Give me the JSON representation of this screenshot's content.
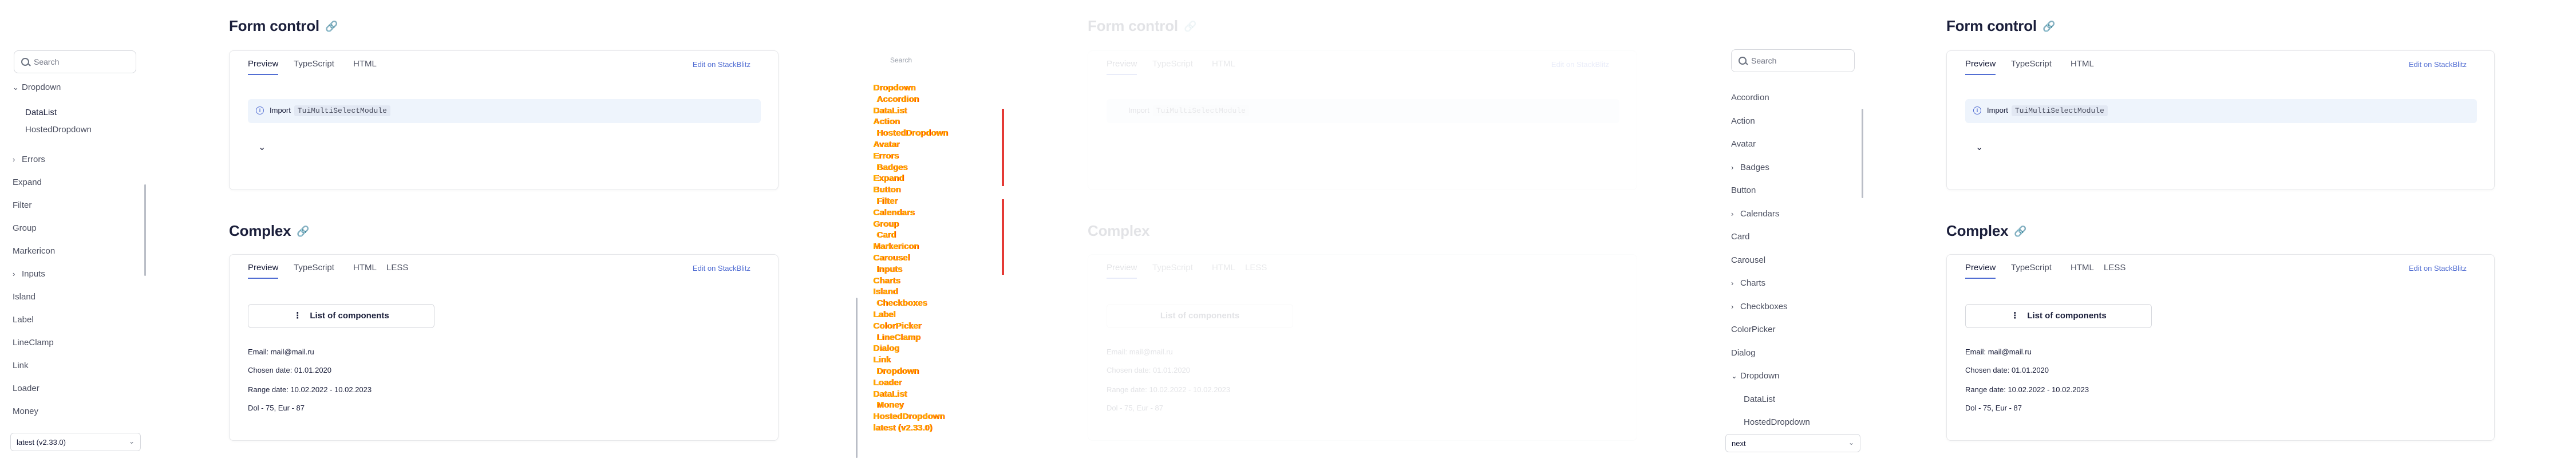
{
  "panel1": {
    "search_placeholder": "Search",
    "nav": [
      {
        "label": "Dropdown",
        "chevron": "down",
        "indent": 0,
        "active": false
      },
      {
        "label": "DataList",
        "chevron": "",
        "indent": 1,
        "active": true
      },
      {
        "label": "HostedDropdown",
        "chevron": "",
        "indent": 1,
        "active": false
      },
      {
        "label": "Errors",
        "chevron": "right",
        "indent": 0,
        "active": false
      },
      {
        "label": "Expand",
        "chevron": "",
        "indent": 0,
        "active": false
      },
      {
        "label": "Filter",
        "chevron": "",
        "indent": 0,
        "active": false
      },
      {
        "label": "Group",
        "chevron": "",
        "indent": 0,
        "active": false
      },
      {
        "label": "Markericon",
        "chevron": "",
        "indent": 0,
        "active": false
      },
      {
        "label": "Inputs",
        "chevron": "right",
        "indent": 0,
        "active": false
      },
      {
        "label": "Island",
        "chevron": "",
        "indent": 0,
        "active": false
      },
      {
        "label": "Label",
        "chevron": "",
        "indent": 0,
        "active": false
      },
      {
        "label": "LineClamp",
        "chevron": "",
        "indent": 0,
        "active": false
      },
      {
        "label": "Link",
        "chevron": "",
        "indent": 0,
        "active": false
      },
      {
        "label": "Loader",
        "chevron": "",
        "indent": 0,
        "active": false
      },
      {
        "label": "Money",
        "chevron": "",
        "indent": 0,
        "active": false
      }
    ],
    "version": "latest (v2.33.0)"
  },
  "content": {
    "section1_title": "Form control",
    "section2_title": "Complex",
    "tabs1": [
      "Preview",
      "TypeScript",
      "HTML"
    ],
    "tabs2": [
      "Preview",
      "TypeScript",
      "HTML",
      "LESS"
    ],
    "edit_label": "Edit on StackBlitz",
    "import_label": "Import",
    "module_name": "TuiMultiSelectModule",
    "list_button": "List of components",
    "email": "Email: mail@mail.ru",
    "chosen_date": "Chosen date: 01.01.2020",
    "range_date": "Range date: 10.02.2022 - 10.02.2023",
    "money": "Dol - 75, Eur - 87"
  },
  "glitch": {
    "search_placeholder": "Search",
    "lines": [
      "Dropdown",
      "Accordion",
      "DataList",
      "Action",
      "HostedDropdown",
      "Avatar",
      "Errors",
      "Badges",
      "Expand",
      "Button",
      "Filter",
      "Calendars",
      "Group",
      "Card",
      "Markericon",
      "Carousel",
      "Inputs",
      "Charts",
      "Island",
      "Checkboxes",
      "Label",
      "ColorPicker",
      "LineClamp",
      "Dialog",
      "Link",
      "Dropdown",
      "Loader",
      "DataList",
      "Money",
      "HostedDropdown",
      "latest (v2.33.0)"
    ]
  },
  "panel4": {
    "search_placeholder": "Search",
    "nav": [
      {
        "label": "Accordion",
        "chevron": ""
      },
      {
        "label": "Action",
        "chevron": ""
      },
      {
        "label": "Avatar",
        "chevron": ""
      },
      {
        "label": "Badges",
        "chevron": "right"
      },
      {
        "label": "Button",
        "chevron": ""
      },
      {
        "label": "Calendars",
        "chevron": "right"
      },
      {
        "label": "Card",
        "chevron": ""
      },
      {
        "label": "Carousel",
        "chevron": ""
      },
      {
        "label": "Charts",
        "chevron": "right"
      },
      {
        "label": "Checkboxes",
        "chevron": "right"
      },
      {
        "label": "ColorPicker",
        "chevron": ""
      },
      {
        "label": "Dialog",
        "chevron": ""
      },
      {
        "label": "Dropdown",
        "chevron": "down"
      },
      {
        "label": "DataList",
        "chevron": "",
        "sub": true
      },
      {
        "label": "HostedDropdown",
        "chevron": "",
        "sub": true
      }
    ],
    "version": "next"
  }
}
